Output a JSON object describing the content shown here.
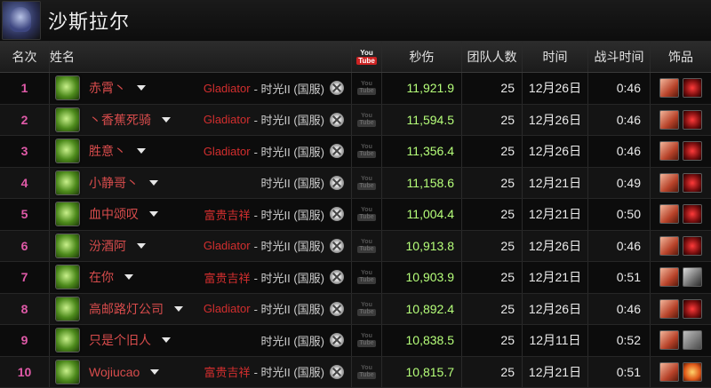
{
  "boss": {
    "name": "沙斯拉尔"
  },
  "headers": {
    "rank": "名次",
    "name": "姓名",
    "youtube_top": "You",
    "youtube_bottom": "Tube",
    "dps": "秒伤",
    "raid_size": "团队人数",
    "date": "时间",
    "duration": "战斗时间",
    "trinkets": "饰品"
  },
  "rows": [
    {
      "rank": "1",
      "name": "赤霄丶",
      "guild": "Gladiator",
      "realm": "- 时光II (国服)",
      "dps": "11,921.9",
      "raid": "25",
      "date": "12月26日",
      "duration": "0:46",
      "trinkets": [
        "t-red",
        "t-dark"
      ]
    },
    {
      "rank": "2",
      "name": "丶香蕉死骑",
      "guild": "Gladiator",
      "realm": "- 时光II (国服)",
      "dps": "11,594.5",
      "raid": "25",
      "date": "12月26日",
      "duration": "0:46",
      "trinkets": [
        "t-red",
        "t-dark"
      ]
    },
    {
      "rank": "3",
      "name": "胜意丶",
      "guild": "Gladiator",
      "realm": "- 时光II (国服)",
      "dps": "11,356.4",
      "raid": "25",
      "date": "12月26日",
      "duration": "0:46",
      "trinkets": [
        "t-red",
        "t-dark"
      ]
    },
    {
      "rank": "4",
      "name": "小静哥丶",
      "guild": "",
      "realm": "时光II (国服)",
      "dps": "11,158.6",
      "raid": "25",
      "date": "12月21日",
      "duration": "0:49",
      "trinkets": [
        "t-red",
        "t-dark"
      ]
    },
    {
      "rank": "5",
      "name": "血中颂叹",
      "guild": "富贵吉祥",
      "realm": "- 时光II (国服)",
      "dps": "11,004.4",
      "raid": "25",
      "date": "12月21日",
      "duration": "0:50",
      "trinkets": [
        "t-red",
        "t-dark"
      ]
    },
    {
      "rank": "6",
      "name": "汾酒阿",
      "guild": "Gladiator",
      "realm": "- 时光II (国服)",
      "dps": "10,913.8",
      "raid": "25",
      "date": "12月26日",
      "duration": "0:46",
      "trinkets": [
        "t-red",
        "t-dark"
      ]
    },
    {
      "rank": "7",
      "name": "在你",
      "guild": "富贵吉祥",
      "realm": "- 时光II (国服)",
      "dps": "10,903.9",
      "raid": "25",
      "date": "12月21日",
      "duration": "0:51",
      "trinkets": [
        "t-red",
        "t-grey"
      ]
    },
    {
      "rank": "8",
      "name": "高邮路灯公司",
      "guild": "Gladiator",
      "realm": "- 时光II (国服)",
      "dps": "10,892.4",
      "raid": "25",
      "date": "12月26日",
      "duration": "0:46",
      "trinkets": [
        "t-red",
        "t-dark"
      ]
    },
    {
      "rank": "9",
      "name": "只是个旧人",
      "guild": "",
      "realm": "时光II (国服)",
      "dps": "10,838.5",
      "raid": "25",
      "date": "12月11日",
      "duration": "0:52",
      "trinkets": [
        "t-red",
        "t-stone"
      ]
    },
    {
      "rank": "10",
      "name": "Wojiucao",
      "guild": "富贵吉祥",
      "realm": "- 时光II (国服)",
      "dps": "10,815.7",
      "raid": "25",
      "date": "12月21日",
      "duration": "0:51",
      "trinkets": [
        "t-red",
        "t-orange"
      ]
    }
  ],
  "icons": {
    "spec": "frost-spec-icon",
    "dropdown": "chevron-down-icon",
    "armory": "armory-x-icon",
    "youtube": "youtube-icon"
  }
}
